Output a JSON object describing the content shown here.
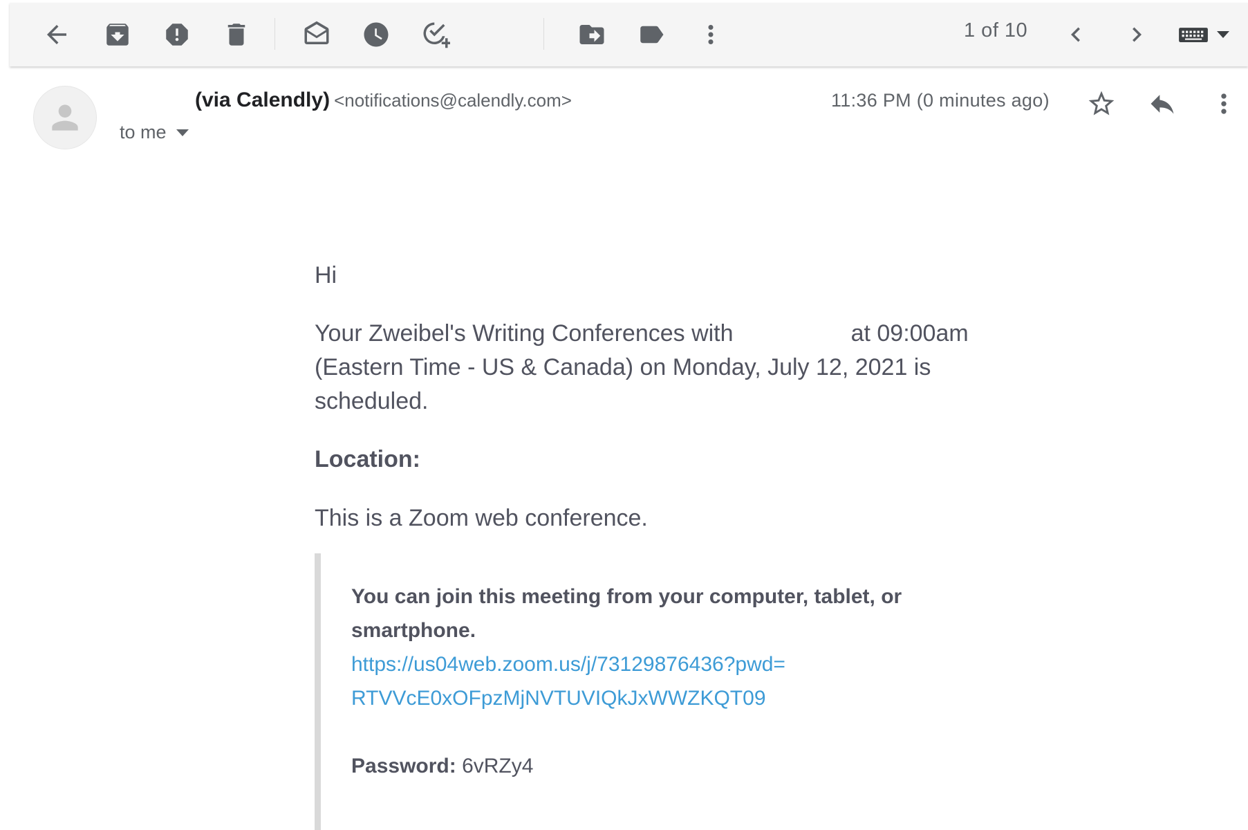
{
  "toolbar": {
    "buttons": [
      {
        "name": "back",
        "icon": "arrow-back-icon"
      },
      {
        "name": "archive",
        "icon": "archive-icon"
      },
      {
        "name": "report-spam",
        "icon": "report-spam-icon"
      },
      {
        "name": "delete",
        "icon": "trash-icon"
      },
      {
        "name": "mark-unread",
        "icon": "mark-unread-icon"
      },
      {
        "name": "snooze",
        "icon": "clock-icon"
      },
      {
        "name": "add-to-tasks",
        "icon": "add-task-icon"
      },
      {
        "name": "move-to",
        "icon": "move-to-icon"
      },
      {
        "name": "labels",
        "icon": "label-icon"
      },
      {
        "name": "more",
        "icon": "more-vert-icon"
      }
    ],
    "pager_text": "1 of 10",
    "keyboard_icon": "keyboard-icon"
  },
  "email": {
    "sender_name": "(via Calendly)",
    "sender_email": "<notifications@calendly.com>",
    "recipient": "to me",
    "timestamp": "11:36 PM (0 minutes ago)",
    "greeting": "Hi",
    "paragraph1": "Your Zweibel's Writing Conferences with                  at 09:00am (Eastern Time - US & Canada) on Monday, July 12, 2021 is scheduled.",
    "location_label": "Location:",
    "paragraph2": "This is a Zoom web conference.",
    "join_text": "You can join this meeting from your computer, tablet, or smartphone.",
    "zoom_link_line1": "https://us04web.zoom.us/j/73129876436?pwd=",
    "zoom_link_line2": "RTVVcE0xOFpzMjNVTUVIQkJxWWZKQT09",
    "password_label": "Password:",
    "password_value": "6vRZy4"
  },
  "colors": {
    "link": "#3d9bd6",
    "body_text": "#51535f",
    "icon": "#5f6368",
    "toolbar_bg": "#f5f5f5"
  }
}
